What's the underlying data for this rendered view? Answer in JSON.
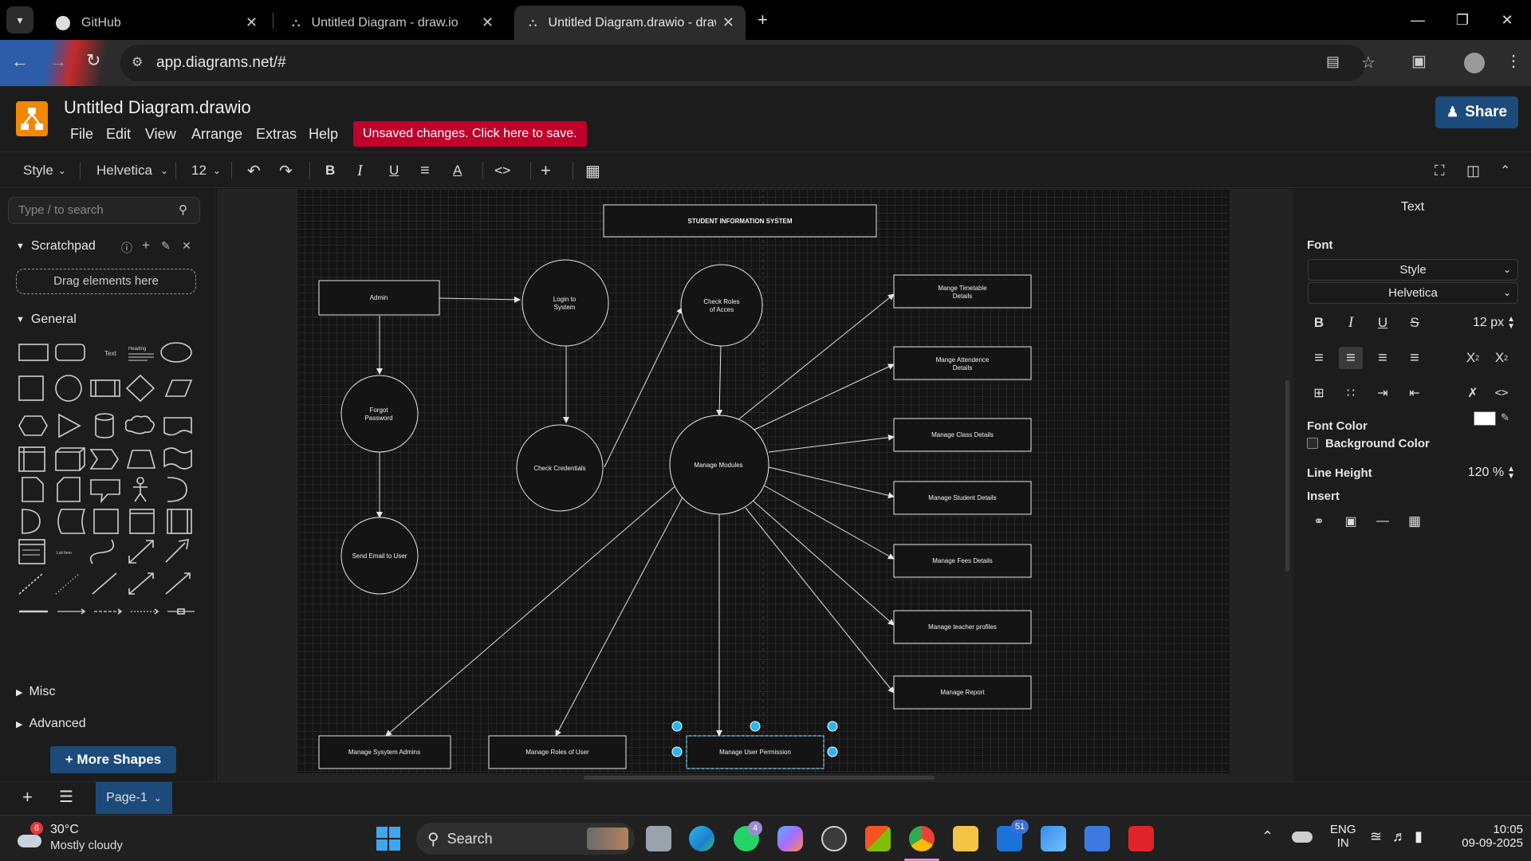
{
  "browser": {
    "tabs": [
      {
        "label": "GitHub"
      },
      {
        "label": "Untitled Diagram - draw.io"
      },
      {
        "label": "Untitled Diagram.drawio - draw"
      }
    ],
    "url": "app.diagrams.net/#"
  },
  "app": {
    "title": "Untitled Diagram.drawio",
    "menu": [
      "File",
      "Edit",
      "View",
      "Arrange",
      "Extras",
      "Help"
    ],
    "unsaved": "Unsaved changes. Click here to save.",
    "share": "Share"
  },
  "toolbar": {
    "style": "Style",
    "font": "Helvetica",
    "size": "12"
  },
  "left": {
    "search_placeholder": "Type / to search",
    "scratchpad": "Scratchpad",
    "drag": "Drag elements here",
    "general": "General",
    "text_shape": "Text",
    "heading_shape": "Heading",
    "list_item_shape": "List Item",
    "misc": "Misc",
    "advanced": "Advanced",
    "more_shapes": "More Shapes"
  },
  "diagram": {
    "title": "STUDENT INFORMATION SYSTEM",
    "admin": "Admin",
    "login": [
      "Login to",
      "System"
    ],
    "check_roles": [
      "Check Roles",
      "of Acces"
    ],
    "forgot": [
      "Forgot",
      "Password"
    ],
    "check_credentials": "Check Credentials",
    "manage_modules": "Manage Modules",
    "send_email": "Send Email to User",
    "timetable": [
      "Mange Timetable",
      "Details"
    ],
    "attendence": [
      "Mange Attendence",
      "Details"
    ],
    "class": "Manage Class Details",
    "student": "Manage Student Details",
    "fees": "Manage Fees Details",
    "teacher": "Manage teacher profiles",
    "report": "Manage Report",
    "sys_admins": "Manage Sysytem Admins",
    "roles_user": "Manage Roles of User",
    "permission": "Manage User Permission"
  },
  "right": {
    "header": "Text",
    "font": "Font",
    "style": "Style",
    "family": "Helvetica",
    "size": "12 px",
    "font_color": "Font Color",
    "bg_color": "Background Color",
    "line_height_label": "Line Height",
    "line_height": "120 %",
    "insert": "Insert"
  },
  "pages": {
    "current": "Page-1"
  },
  "taskbar": {
    "weather_temp": "30°C",
    "weather_desc": "Mostly cloudy",
    "weather_badge": "6",
    "search": "Search",
    "whatsapp_badge": "4",
    "mail_badge": "51",
    "lang1": "ENG",
    "lang2": "IN",
    "time": "10:05",
    "date": "09-09-2025"
  },
  "colors": {
    "accent": "#1c4a7b",
    "unsaved": "#c0002b",
    "logo": "#f08705",
    "selection": "#29b6f2"
  }
}
